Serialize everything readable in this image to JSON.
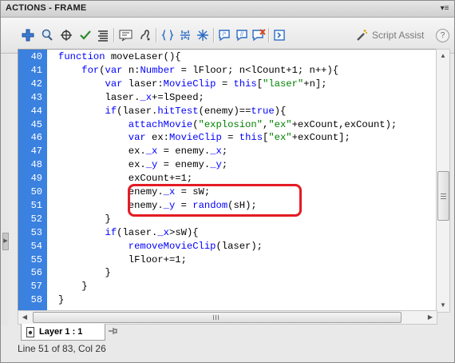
{
  "window": {
    "title": "ACTIONS - FRAME"
  },
  "toolbar": {
    "icons": [
      "add-statement-icon",
      "find-icon",
      "target-path-icon",
      "check-syntax-icon",
      "auto-format-icon",
      "code-hint-icon",
      "debug-options-icon",
      "collapse-between-braces-icon",
      "collapse-selection-icon",
      "expand-all-icon",
      "apply-block-comment-icon",
      "apply-line-comment-icon",
      "remove-comment-icon",
      "show-hide-toolbox-icon"
    ],
    "script_assist_label": "Script Assist",
    "help_label": "?"
  },
  "editor": {
    "gutter_color": "#3a81e0",
    "lines": [
      {
        "num": "40",
        "tokens": [
          {
            "t": "function",
            "c": "kw"
          },
          {
            "t": " moveLaser(){",
            "c": ""
          }
        ]
      },
      {
        "num": "41",
        "tokens": [
          {
            "t": "    ",
            "c": ""
          },
          {
            "t": "for",
            "c": "kw"
          },
          {
            "t": "(",
            "c": ""
          },
          {
            "t": "var",
            "c": "kw"
          },
          {
            "t": " n:",
            "c": ""
          },
          {
            "t": "Number",
            "c": "kw"
          },
          {
            "t": " = lFloor; n<lCount+1; n++){",
            "c": ""
          }
        ]
      },
      {
        "num": "42",
        "tokens": [
          {
            "t": "        ",
            "c": ""
          },
          {
            "t": "var",
            "c": "kw"
          },
          {
            "t": " laser:",
            "c": ""
          },
          {
            "t": "MovieClip",
            "c": "kw"
          },
          {
            "t": " = ",
            "c": ""
          },
          {
            "t": "this",
            "c": "kw"
          },
          {
            "t": "[",
            "c": ""
          },
          {
            "t": "\"laser\"",
            "c": "str"
          },
          {
            "t": "+n];",
            "c": ""
          }
        ]
      },
      {
        "num": "43",
        "tokens": [
          {
            "t": "        laser.",
            "c": ""
          },
          {
            "t": "_x",
            "c": "kw"
          },
          {
            "t": "+=lSpeed;",
            "c": ""
          }
        ]
      },
      {
        "num": "44",
        "tokens": [
          {
            "t": "        ",
            "c": ""
          },
          {
            "t": "if",
            "c": "kw"
          },
          {
            "t": "(laser.",
            "c": ""
          },
          {
            "t": "hitTest",
            "c": "kw"
          },
          {
            "t": "(enemy)==",
            "c": ""
          },
          {
            "t": "true",
            "c": "kw"
          },
          {
            "t": "){",
            "c": ""
          }
        ]
      },
      {
        "num": "45",
        "tokens": [
          {
            "t": "            ",
            "c": ""
          },
          {
            "t": "attachMovie",
            "c": "kw"
          },
          {
            "t": "(",
            "c": ""
          },
          {
            "t": "\"explosion\"",
            "c": "str"
          },
          {
            "t": ",",
            "c": ""
          },
          {
            "t": "\"ex\"",
            "c": "str"
          },
          {
            "t": "+exCount,exCount);",
            "c": ""
          }
        ]
      },
      {
        "num": "46",
        "tokens": [
          {
            "t": "            ",
            "c": ""
          },
          {
            "t": "var",
            "c": "kw"
          },
          {
            "t": " ex:",
            "c": ""
          },
          {
            "t": "MovieClip",
            "c": "kw"
          },
          {
            "t": " = ",
            "c": ""
          },
          {
            "t": "this",
            "c": "kw"
          },
          {
            "t": "[",
            "c": ""
          },
          {
            "t": "\"ex\"",
            "c": "str"
          },
          {
            "t": "+exCount];",
            "c": ""
          }
        ]
      },
      {
        "num": "47",
        "tokens": [
          {
            "t": "            ex.",
            "c": ""
          },
          {
            "t": "_x",
            "c": "kw"
          },
          {
            "t": " = enemy.",
            "c": ""
          },
          {
            "t": "_x",
            "c": "kw"
          },
          {
            "t": ";",
            "c": ""
          }
        ]
      },
      {
        "num": "48",
        "tokens": [
          {
            "t": "            ex.",
            "c": ""
          },
          {
            "t": "_y",
            "c": "kw"
          },
          {
            "t": " = enemy.",
            "c": ""
          },
          {
            "t": "_y",
            "c": "kw"
          },
          {
            "t": ";",
            "c": ""
          }
        ]
      },
      {
        "num": "49",
        "tokens": [
          {
            "t": "            exCount+=1;",
            "c": ""
          }
        ]
      },
      {
        "num": "50",
        "tokens": [
          {
            "t": "            enemy.",
            "c": ""
          },
          {
            "t": "_x",
            "c": "kw"
          },
          {
            "t": " = sW;",
            "c": ""
          }
        ]
      },
      {
        "num": "51",
        "tokens": [
          {
            "t": "            enemy.",
            "c": ""
          },
          {
            "t": "_y",
            "c": "kw"
          },
          {
            "t": " = ",
            "c": ""
          },
          {
            "t": "random",
            "c": "kw"
          },
          {
            "t": "(sH);",
            "c": ""
          }
        ]
      },
      {
        "num": "52",
        "tokens": [
          {
            "t": "        }",
            "c": ""
          }
        ]
      },
      {
        "num": "53",
        "tokens": [
          {
            "t": "        ",
            "c": ""
          },
          {
            "t": "if",
            "c": "kw"
          },
          {
            "t": "(laser.",
            "c": ""
          },
          {
            "t": "_x",
            "c": "kw"
          },
          {
            "t": ">sW){",
            "c": ""
          }
        ]
      },
      {
        "num": "54",
        "tokens": [
          {
            "t": "            ",
            "c": ""
          },
          {
            "t": "removeMovieClip",
            "c": "kw"
          },
          {
            "t": "(laser);",
            "c": ""
          }
        ]
      },
      {
        "num": "55",
        "tokens": [
          {
            "t": "            lFloor+=1;",
            "c": ""
          }
        ]
      },
      {
        "num": "56",
        "tokens": [
          {
            "t": "        }",
            "c": ""
          }
        ]
      },
      {
        "num": "57",
        "tokens": [
          {
            "t": "    }",
            "c": ""
          }
        ]
      },
      {
        "num": "58",
        "tokens": [
          {
            "t": "}",
            "c": ""
          }
        ]
      }
    ],
    "highlight_color": "#e31b23"
  },
  "tabs": {
    "layer_label": "Layer 1 : 1"
  },
  "status": {
    "text": "Line 51 of 83, Col 26"
  }
}
